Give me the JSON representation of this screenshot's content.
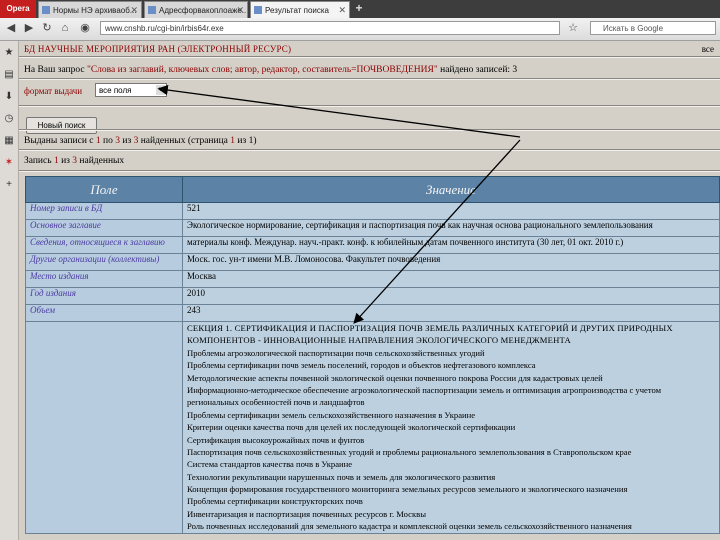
{
  "browser": {
    "opera_label": "Opera",
    "tabs": [
      {
        "label": "Нормы НЭ архиваоб..."
      },
      {
        "label": "Адресфорвакоплоаже..."
      },
      {
        "label": "Результат поиска"
      }
    ],
    "url": "www.cnshb.ru/cgi-bin/irbis64r.exe",
    "search_placeholder": "Искать в Google"
  },
  "page": {
    "db_title": "БД НАУЧНЫЕ МЕРОПРИЯТИЯ РАН (ЭЛЕКТРОННЫЙ РЕСУРС)",
    "db_all": "все",
    "query": {
      "prefix": "На Ваш запрос ",
      "term": "\"Слова из заглавий, ключевых слов; автор, редактор, составитель=ПОЧВОВЕДЕНИЯ\"",
      "suffix": " найдено записей: 3"
    },
    "format_label": "формат выдачи",
    "format_value": "все поля",
    "new_search_button": "Новый поиск",
    "found": {
      "t1": "Выданы записи с ",
      "from": "1",
      "t2": " по ",
      "to": "3",
      "t3": " из ",
      "total": "3",
      "t4": " найденных (страница ",
      "page": "1",
      "t5": " из 1)"
    },
    "record": {
      "t1": "Запись ",
      "n": "1",
      "t2": " из ",
      "total": "3",
      "t3": " найденных"
    },
    "table": {
      "col_field": "Поле",
      "col_value": "Значение",
      "rows": [
        {
          "field": "Номер записи в БД",
          "value": "521"
        },
        {
          "field": "Основное заглавие",
          "value": "Экологическое нормирование, сертификация и паспортизация почв как научная основа рационального землепользования"
        },
        {
          "field": "Сведения, относящиеся к заглавию",
          "value": "материалы конф. Междунар. науч.-практ. конф. к юбилейным датам почвенного института (30 лет, 01 окт. 2010 г.)"
        },
        {
          "field": "Другие организации (коллективы)",
          "value": "Моск. гос. ун-т имени М.В. Ломоносова. Факультет почвоведения"
        },
        {
          "field": "Место издания",
          "value": "Москва"
        },
        {
          "field": "Год издания",
          "value": "2010"
        },
        {
          "field": "Объем",
          "value": "243"
        }
      ],
      "contents_field": "",
      "contents": [
        "СЕКЦИЯ 1. СЕРТИФИКАЦИЯ И ПАСПОРТИЗАЦИЯ ПОЧВ ЗЕМЕЛЬ РАЗЛИЧНЫХ КАТЕГОРИЙ И ДРУГИХ ПРИРОДНЫХ",
        "КОМПОНЕНТОВ - ИННОВАЦИОННЫЕ НАПРАВЛЕНИЯ ЭКОЛОГИЧЕСКОГО МЕНЕДЖМЕНТА",
        "Проблемы агроэкологической паспортизации почв сельскохозяйственных угодий",
        "Проблемы сертификации почв земель поселений, городов и объектов нефтегазового комплекса",
        "Методологические аспекты почвенной экологической оценки почвенного покрова России для кадастровых целей",
        "Информационно-методическое обеспечение агроэкологической паспортизации земель и оптимизация агропроизводства с учетом",
        "региональных особенностей почв и ландшафтов",
        "Проблемы сертификации земель сельскохозяйственного назначения в Украине",
        "Критерии оценки качества почв для целей их последующей экологической сертификации",
        "Сертификация высокоурожайных почв и фунтов",
        "Паспортизация почв сельскохозяйственных угодий и проблемы рационального землепользования в Ставропольском крае",
        "Система стандартов качества почв в Украине",
        "Технологии рекультивации нарушенных почв и земель для экологического развития",
        "Концепция формирования государственного мониторинга земельных ресурсов земельного и экологического назначения",
        "Проблемы сертификации конструкторских почв",
        "Инвентаризация и паспортизация почвенных ресурсов г. Москвы",
        "Роль почвенных исследований для земельного кадастра и комплексной оценки земель сельскохозяйственного назначения"
      ]
    }
  }
}
